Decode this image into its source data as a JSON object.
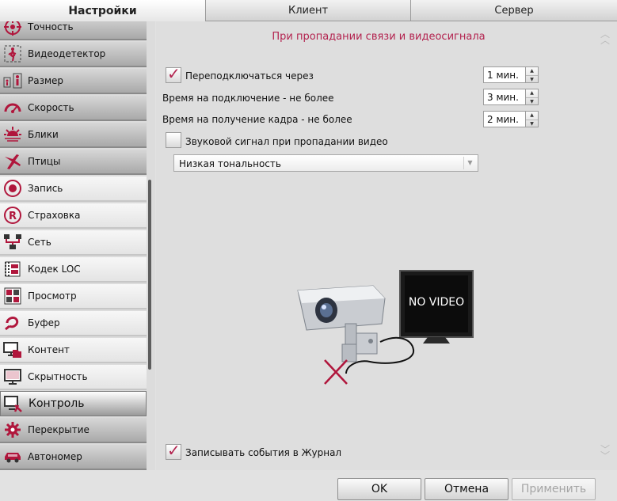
{
  "tabs": [
    {
      "label": "Настройки",
      "active": true
    },
    {
      "label": "Клиент",
      "active": false
    },
    {
      "label": "Сервер",
      "active": false
    }
  ],
  "sidebar": {
    "items": [
      {
        "label": "Точность",
        "icon": "target-icon"
      },
      {
        "label": "Видеодетектор",
        "icon": "walking-person-icon"
      },
      {
        "label": "Размер",
        "icon": "size-figures-icon"
      },
      {
        "label": "Скорость",
        "icon": "speedometer-icon"
      },
      {
        "label": "Блики",
        "icon": "sunset-icon"
      },
      {
        "label": "Птицы",
        "icon": "bird-icon"
      },
      {
        "label": "Запись",
        "icon": "record-icon"
      },
      {
        "label": "Страховка",
        "icon": "registered-icon"
      },
      {
        "label": "Сеть",
        "icon": "network-icon"
      },
      {
        "label": "Кодек LOC",
        "icon": "codec-icon"
      },
      {
        "label": "Просмотр",
        "icon": "view-grid-icon"
      },
      {
        "label": "Буфер",
        "icon": "buffer-icon"
      },
      {
        "label": "Контент",
        "icon": "monitor-folder-icon"
      },
      {
        "label": "Скрытность",
        "icon": "monitor-icon"
      },
      {
        "label": "Контроль",
        "icon": "control-icon",
        "active": true
      },
      {
        "label": "Перекрытие",
        "icon": "gear-icon"
      },
      {
        "label": "Автономер",
        "icon": "car-icon"
      }
    ]
  },
  "main": {
    "title": "При пропадании связи и видеосигнала",
    "reconnect": {
      "label": "Переподключаться через",
      "checked": true,
      "value": "1 мин."
    },
    "connect_time": {
      "label": "Время на подключение - не более",
      "value": "3 мин."
    },
    "frame_time": {
      "label": "Время на получение кадра - не более",
      "value": "2 мин."
    },
    "sound_signal": {
      "label": "Звуковой сигнал при пропадании видео",
      "checked": false
    },
    "tone_select": {
      "value": "Низкая тональность"
    },
    "illustration": {
      "screen_text": "NO VIDEO"
    },
    "log_events": {
      "label": "Записывать события в Журнал",
      "checked": true
    }
  },
  "footer": {
    "ok": "OK",
    "cancel": "Отмена",
    "apply": "Применить"
  },
  "colors": {
    "accent": "#b3234f",
    "icon_red": "#b0163c"
  }
}
